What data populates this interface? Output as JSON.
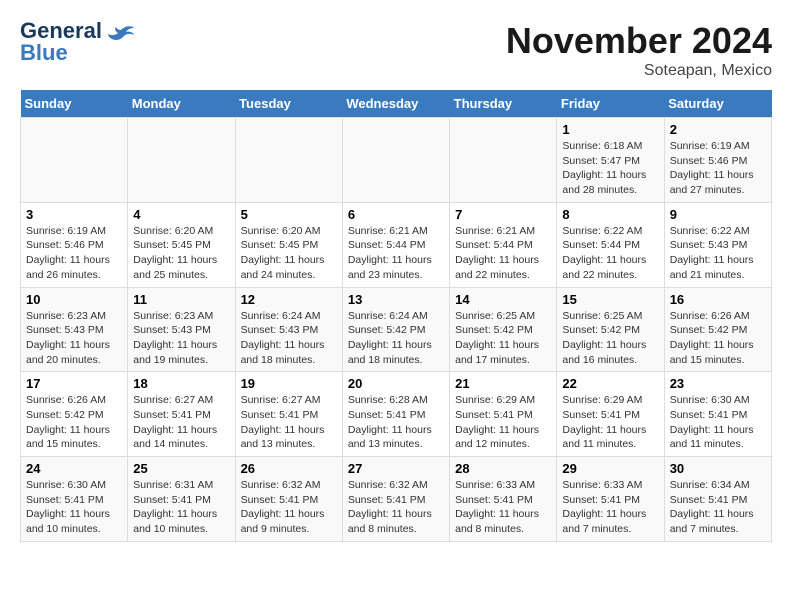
{
  "logo": {
    "line1": "General",
    "line2": "Blue"
  },
  "header": {
    "title": "November 2024",
    "subtitle": "Soteapan, Mexico"
  },
  "weekdays": [
    "Sunday",
    "Monday",
    "Tuesday",
    "Wednesday",
    "Thursday",
    "Friday",
    "Saturday"
  ],
  "weeks": [
    [
      {
        "day": "",
        "info": ""
      },
      {
        "day": "",
        "info": ""
      },
      {
        "day": "",
        "info": ""
      },
      {
        "day": "",
        "info": ""
      },
      {
        "day": "",
        "info": ""
      },
      {
        "day": "1",
        "info": "Sunrise: 6:18 AM\nSunset: 5:47 PM\nDaylight: 11 hours and 28 minutes."
      },
      {
        "day": "2",
        "info": "Sunrise: 6:19 AM\nSunset: 5:46 PM\nDaylight: 11 hours and 27 minutes."
      }
    ],
    [
      {
        "day": "3",
        "info": "Sunrise: 6:19 AM\nSunset: 5:46 PM\nDaylight: 11 hours and 26 minutes."
      },
      {
        "day": "4",
        "info": "Sunrise: 6:20 AM\nSunset: 5:45 PM\nDaylight: 11 hours and 25 minutes."
      },
      {
        "day": "5",
        "info": "Sunrise: 6:20 AM\nSunset: 5:45 PM\nDaylight: 11 hours and 24 minutes."
      },
      {
        "day": "6",
        "info": "Sunrise: 6:21 AM\nSunset: 5:44 PM\nDaylight: 11 hours and 23 minutes."
      },
      {
        "day": "7",
        "info": "Sunrise: 6:21 AM\nSunset: 5:44 PM\nDaylight: 11 hours and 22 minutes."
      },
      {
        "day": "8",
        "info": "Sunrise: 6:22 AM\nSunset: 5:44 PM\nDaylight: 11 hours and 22 minutes."
      },
      {
        "day": "9",
        "info": "Sunrise: 6:22 AM\nSunset: 5:43 PM\nDaylight: 11 hours and 21 minutes."
      }
    ],
    [
      {
        "day": "10",
        "info": "Sunrise: 6:23 AM\nSunset: 5:43 PM\nDaylight: 11 hours and 20 minutes."
      },
      {
        "day": "11",
        "info": "Sunrise: 6:23 AM\nSunset: 5:43 PM\nDaylight: 11 hours and 19 minutes."
      },
      {
        "day": "12",
        "info": "Sunrise: 6:24 AM\nSunset: 5:43 PM\nDaylight: 11 hours and 18 minutes."
      },
      {
        "day": "13",
        "info": "Sunrise: 6:24 AM\nSunset: 5:42 PM\nDaylight: 11 hours and 18 minutes."
      },
      {
        "day": "14",
        "info": "Sunrise: 6:25 AM\nSunset: 5:42 PM\nDaylight: 11 hours and 17 minutes."
      },
      {
        "day": "15",
        "info": "Sunrise: 6:25 AM\nSunset: 5:42 PM\nDaylight: 11 hours and 16 minutes."
      },
      {
        "day": "16",
        "info": "Sunrise: 6:26 AM\nSunset: 5:42 PM\nDaylight: 11 hours and 15 minutes."
      }
    ],
    [
      {
        "day": "17",
        "info": "Sunrise: 6:26 AM\nSunset: 5:42 PM\nDaylight: 11 hours and 15 minutes."
      },
      {
        "day": "18",
        "info": "Sunrise: 6:27 AM\nSunset: 5:41 PM\nDaylight: 11 hours and 14 minutes."
      },
      {
        "day": "19",
        "info": "Sunrise: 6:27 AM\nSunset: 5:41 PM\nDaylight: 11 hours and 13 minutes."
      },
      {
        "day": "20",
        "info": "Sunrise: 6:28 AM\nSunset: 5:41 PM\nDaylight: 11 hours and 13 minutes."
      },
      {
        "day": "21",
        "info": "Sunrise: 6:29 AM\nSunset: 5:41 PM\nDaylight: 11 hours and 12 minutes."
      },
      {
        "day": "22",
        "info": "Sunrise: 6:29 AM\nSunset: 5:41 PM\nDaylight: 11 hours and 11 minutes."
      },
      {
        "day": "23",
        "info": "Sunrise: 6:30 AM\nSunset: 5:41 PM\nDaylight: 11 hours and 11 minutes."
      }
    ],
    [
      {
        "day": "24",
        "info": "Sunrise: 6:30 AM\nSunset: 5:41 PM\nDaylight: 11 hours and 10 minutes."
      },
      {
        "day": "25",
        "info": "Sunrise: 6:31 AM\nSunset: 5:41 PM\nDaylight: 11 hours and 10 minutes."
      },
      {
        "day": "26",
        "info": "Sunrise: 6:32 AM\nSunset: 5:41 PM\nDaylight: 11 hours and 9 minutes."
      },
      {
        "day": "27",
        "info": "Sunrise: 6:32 AM\nSunset: 5:41 PM\nDaylight: 11 hours and 8 minutes."
      },
      {
        "day": "28",
        "info": "Sunrise: 6:33 AM\nSunset: 5:41 PM\nDaylight: 11 hours and 8 minutes."
      },
      {
        "day": "29",
        "info": "Sunrise: 6:33 AM\nSunset: 5:41 PM\nDaylight: 11 hours and 7 minutes."
      },
      {
        "day": "30",
        "info": "Sunrise: 6:34 AM\nSunset: 5:41 PM\nDaylight: 11 hours and 7 minutes."
      }
    ]
  ]
}
